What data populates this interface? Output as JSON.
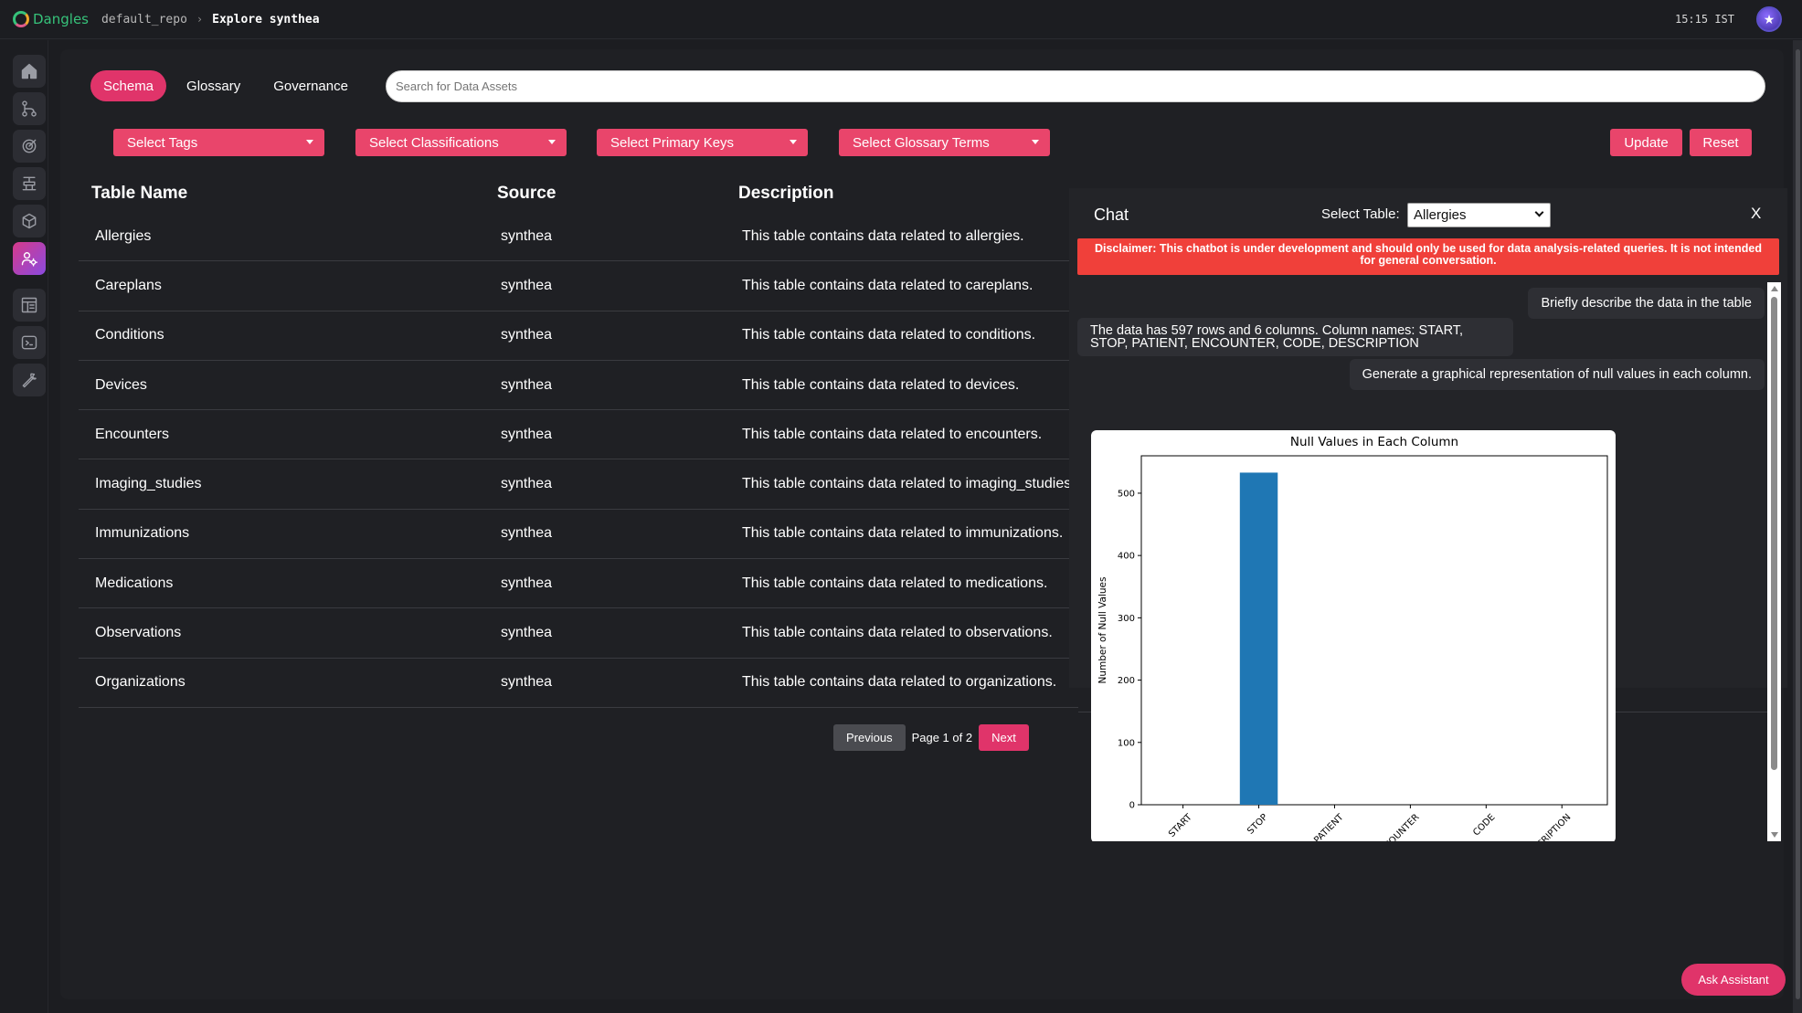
{
  "app": {
    "logo_text": "Dangles",
    "breadcrumb": [
      "default_repo",
      "Explore synthea"
    ],
    "clock": "15:15 IST"
  },
  "sidebar": {
    "items": [
      {
        "icon": "home-icon"
      },
      {
        "icon": "workflow-icon"
      },
      {
        "icon": "target-icon"
      },
      {
        "icon": "pipeline-icon"
      },
      {
        "icon": "cube-icon"
      },
      {
        "icon": "user-settings-icon",
        "active": true
      },
      {
        "icon": "dashboard-icon"
      },
      {
        "icon": "terminal-icon"
      },
      {
        "icon": "wrench-icon"
      }
    ]
  },
  "tabs": [
    "Schema",
    "Glossary",
    "Governance"
  ],
  "search": {
    "placeholder": "Search for Data Assets"
  },
  "filters": [
    "Select Tags",
    "Select Classifications",
    "Select Primary Keys",
    "Select Glossary Terms"
  ],
  "actions": {
    "update": "Update",
    "reset": "Reset"
  },
  "table": {
    "headers": [
      "Table Name",
      "Source",
      "Description"
    ],
    "rows": [
      {
        "name": "Allergies",
        "source": "synthea",
        "description": "This table contains data related to allergies."
      },
      {
        "name": "Careplans",
        "source": "synthea",
        "description": "This table contains data related to careplans."
      },
      {
        "name": "Conditions",
        "source": "synthea",
        "description": "This table contains data related to conditions."
      },
      {
        "name": "Devices",
        "source": "synthea",
        "description": "This table contains data related to devices."
      },
      {
        "name": "Encounters",
        "source": "synthea",
        "description": "This table contains data related to encounters."
      },
      {
        "name": "Imaging_studies",
        "source": "synthea",
        "description": "This table contains data related to imaging_studies."
      },
      {
        "name": "Immunizations",
        "source": "synthea",
        "description": "This table contains data related to immunizations."
      },
      {
        "name": "Medications",
        "source": "synthea",
        "description": "This table contains data related to medications."
      },
      {
        "name": "Observations",
        "source": "synthea",
        "description": "This table contains data related to observations."
      },
      {
        "name": "Organizations",
        "source": "synthea",
        "description": "This table contains data related to organizations."
      }
    ]
  },
  "pagination": {
    "previous": "Previous",
    "info": "Page 1 of 2",
    "next": "Next"
  },
  "chat": {
    "title": "Chat",
    "select_label": "Select Table:",
    "selected_table": "Allergies",
    "close": "X",
    "disclaimer": "Disclaimer: This chatbot is under development and should only be used for data analysis-related queries. It is not intended for general conversation.",
    "messages": [
      {
        "role": "user",
        "text": "Briefly describe the data in the table"
      },
      {
        "role": "bot",
        "text": "The data has 597 rows and 6 columns. Column names: START, STOP, PATIENT, ENCOUNTER, CODE, DESCRIPTION"
      },
      {
        "role": "user",
        "text": "Generate a graphical representation of null values in each column."
      }
    ]
  },
  "ask_assistant": "Ask Assistant",
  "colors": {
    "accent": "#e0346a",
    "filter": "#e9456b",
    "bar": "#1f77b4",
    "disclaimer": "#f0403a"
  },
  "chart_data": {
    "type": "bar",
    "title": "Null Values in Each Column",
    "xlabel": "",
    "ylabel": "Number of Null Values",
    "categories": [
      "START",
      "STOP",
      "PATIENT",
      "ENCOUNTER",
      "CODE",
      "DESCRIPTION"
    ],
    "tick_labels": [
      "START",
      "STOP",
      "PATIENT",
      "ENCOUNTER",
      "CODE",
      "DESCRIPTION"
    ],
    "values": [
      0,
      533,
      0,
      0,
      0,
      0
    ],
    "yticks": [
      0,
      100,
      200,
      300,
      400,
      500
    ],
    "ylim": [
      0,
      560
    ],
    "grid": false
  }
}
